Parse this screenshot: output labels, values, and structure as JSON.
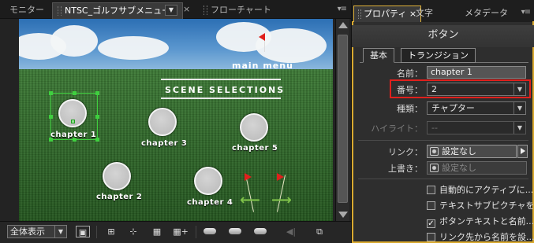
{
  "left_panel": {
    "tabs": {
      "monitor": "モニター",
      "menu": "NTSC_ゴルフサブメニュー",
      "flowchart": "フローチャート"
    },
    "preview": {
      "main_menu": "main menu",
      "scene_selections": "SCENE SELECTIONS",
      "chapters": [
        "chapter 1",
        "chapter 2",
        "chapter 3",
        "chapter 4",
        "chapter 5"
      ]
    },
    "bottom": {
      "zoom_label": "全体表示"
    }
  },
  "right_panel": {
    "tabs": {
      "properties": "プロパティ",
      "text": "文字",
      "metadata": "メタデータ"
    },
    "title": "ボタン",
    "subtabs": {
      "basic": "基本",
      "transition": "トランジション"
    },
    "fields": {
      "name_label": "名前：",
      "name_value": "chapter 1",
      "number_label": "番号：",
      "number_value": "2",
      "type_label": "種類：",
      "type_value": "チャプター",
      "highlight_label": "ハイライト：",
      "highlight_value": "--",
      "link_label": "リンク：",
      "link_value": "設定なし",
      "override_label": "上書き：",
      "override_value": "設定なし"
    },
    "checkboxes": [
      {
        "label": "自動的にアクティブに...",
        "checked": false
      },
      {
        "label": "テキストサブピクチャを...",
        "checked": false
      },
      {
        "label": "ボタンテキストと名前...",
        "checked": true
      },
      {
        "label": "リンク先から名前を設...",
        "checked": false
      }
    ],
    "colors": {
      "accent_frame": "#d9a92f",
      "highlight_box": "#e0201c"
    }
  }
}
